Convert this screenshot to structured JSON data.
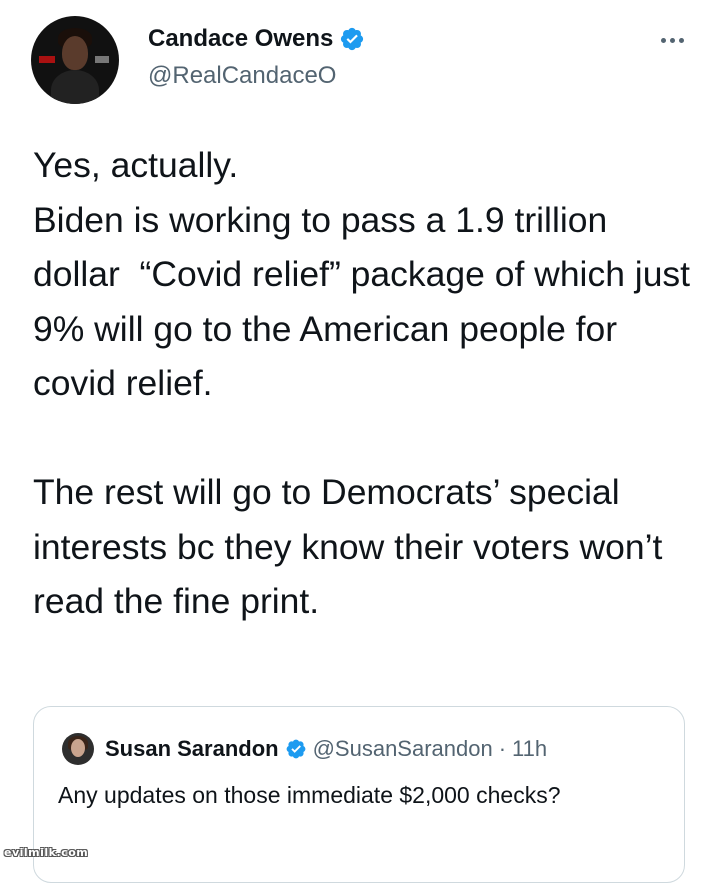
{
  "tweet": {
    "author": {
      "name": "Candace Owens",
      "handle": "@RealCandaceO",
      "verified": true
    },
    "text": "Yes, actually.\nBiden is working to pass a 1.9 trillion dollar  “Covid relief” package of which just 9% will go to the American people for covid relief.\n\nThe rest will go to Democrats’ special interests bc they know their voters won’t read the fine print.",
    "more_icon": "more-horizontal-icon"
  },
  "quote": {
    "author": {
      "name": "Susan Sarandon",
      "handle": "@SusanSarandon",
      "verified": true
    },
    "separator": "·",
    "time": "11h",
    "text": "Any updates on those immediate $2,000 checks?"
  },
  "watermark": "evilmilk.com",
  "colors": {
    "verified_badge": "#1d9bf0",
    "secondary_text": "#536471",
    "primary_text": "#0f1419",
    "border": "#cfd9de"
  }
}
